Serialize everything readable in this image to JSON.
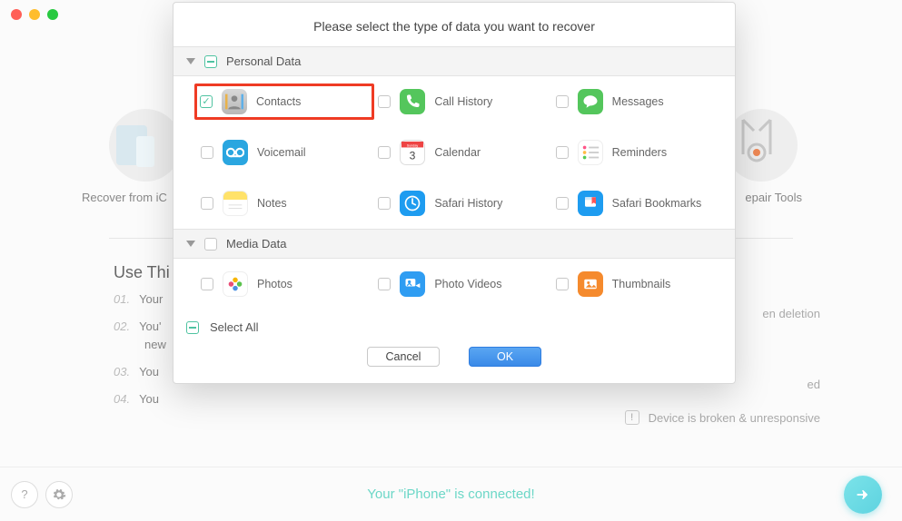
{
  "bg": {
    "left_card_label": "Recover from iC",
    "right_card_label": "epair Tools",
    "use_this_heading": "Use Thi",
    "steps": {
      "s1_num": "01.",
      "s1_text": "Your",
      "s2_num": "02.",
      "s2_text": "You'",
      "s2_wrap": "new",
      "s3_num": "03.",
      "s3_text": "You",
      "s4_num": "04.",
      "s4_text": "You"
    },
    "right_tip1": "en deletion",
    "right_tip2": "ed",
    "right_row": "Device is broken & unresponsive"
  },
  "bottom": {
    "connected_msg": "Your \"iPhone\" is connected!"
  },
  "modal": {
    "title": "Please select the type of data you want to recover",
    "section_personal": "Personal Data",
    "section_media": "Media Data",
    "select_all": "Select All",
    "cancel": "Cancel",
    "ok": "OK",
    "items": {
      "contacts": "Contacts",
      "call_history": "Call History",
      "messages": "Messages",
      "voicemail": "Voicemail",
      "calendar": "Calendar",
      "reminders": "Reminders",
      "notes": "Notes",
      "safari_history": "Safari History",
      "safari_bookmarks": "Safari Bookmarks",
      "photos": "Photos",
      "photo_videos": "Photo Videos",
      "thumbnails": "Thumbnails"
    }
  }
}
